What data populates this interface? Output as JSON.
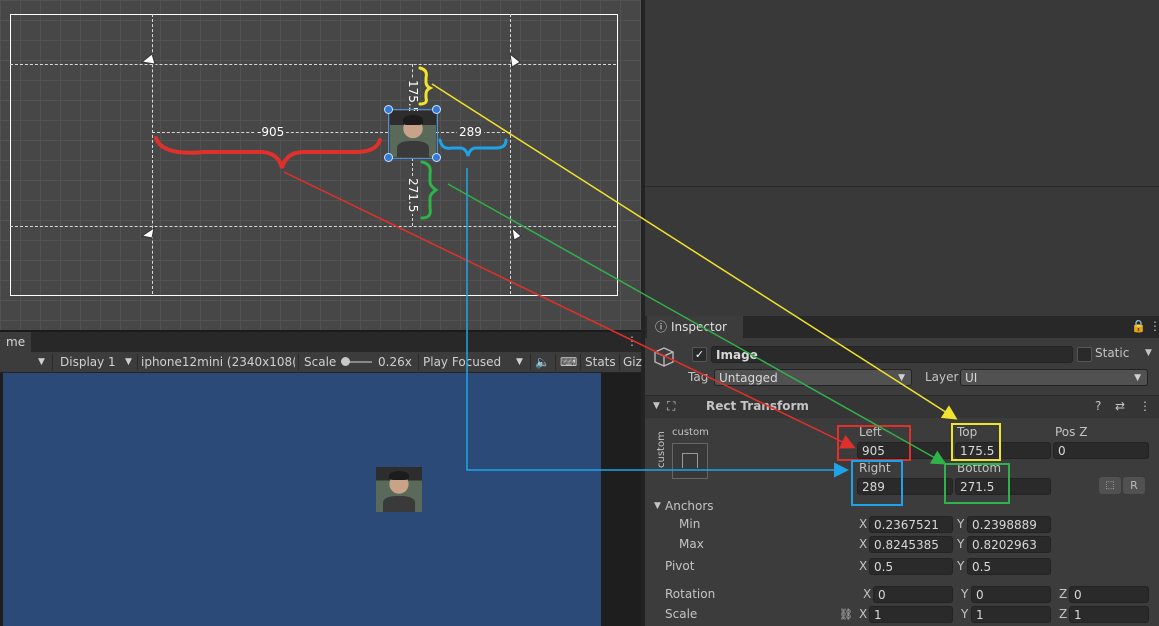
{
  "scene": {
    "dim_left": "-905",
    "dim_right": "289",
    "dim_top": "175.5",
    "dim_bottom": "271.5"
  },
  "game": {
    "tab_label": "me",
    "display": "Display 1",
    "resolution": "iphone12mini (2340x108(",
    "scale_label": "Scale",
    "scale_value": "0.26x",
    "play_mode": "Play Focused",
    "stats": "Stats",
    "gizmos": "Giz"
  },
  "inspector": {
    "tab_label": "Inspector",
    "object_name": "Image",
    "static_label": "Static",
    "tag_label": "Tag",
    "tag_value": "Untagged",
    "layer_label": "Layer",
    "layer_value": "UI",
    "component_title": "Rect Transform",
    "anchor_preset_label": "custom",
    "anchor_preset_side": "custom",
    "left_label": "Left",
    "left_value": "905",
    "top_label": "Top",
    "top_value": "175.5",
    "posz_label": "Pos Z",
    "posz_value": "0",
    "right_label": "Right",
    "right_value": "289",
    "bottom_label": "Bottom",
    "bottom_value": "271.5",
    "r_button": "R",
    "anchors_label": "Anchors",
    "min_label": "Min",
    "min_x": "0.2367521",
    "min_y": "0.2398889",
    "max_label": "Max",
    "max_x": "0.8245385",
    "max_y": "0.8202963",
    "pivot_label": "Pivot",
    "pivot_x": "0.5",
    "pivot_y": "0.5",
    "rotation_label": "Rotation",
    "rot_x": "0",
    "rot_y": "0",
    "rot_z": "0",
    "scale_label": "Scale",
    "scale_x": "1",
    "scale_y": "1",
    "scale_z": "1",
    "axis_x": "X",
    "axis_y": "Y",
    "axis_z": "Z"
  },
  "colors": {
    "left_annotation": "#e0302b",
    "right_annotation": "#1fa3e8",
    "top_annotation": "#f1e42c",
    "bottom_annotation": "#2fb24a"
  }
}
